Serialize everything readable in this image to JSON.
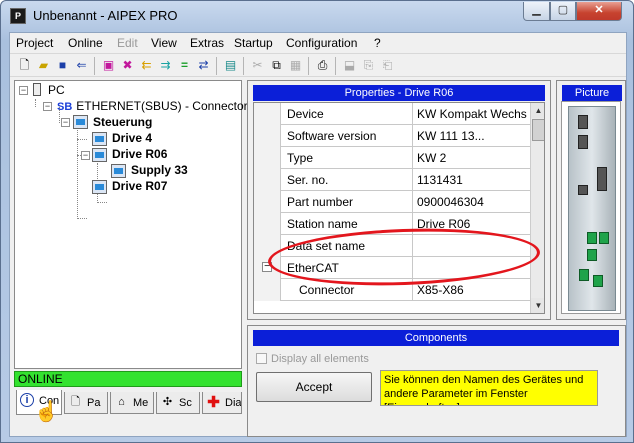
{
  "window": {
    "title": "Unbenannt - AIPEX PRO",
    "app_icon": "P",
    "minimize_glyph": "▁",
    "maximize_glyph": "▢",
    "close_glyph": "✕"
  },
  "menu": [
    "Project",
    "Online",
    "Edit",
    "View",
    "Extras",
    "Startup",
    "Configuration",
    "?"
  ],
  "menu_disabled": [
    "Edit"
  ],
  "toolbar": {
    "icons": [
      "new-file-icon",
      "open-folder-icon",
      "save-icon",
      "login-icon",
      "pink-device-icon",
      "disconnect-icon",
      "arrow-left-icon",
      "arrow-right-icon",
      "equals-icon",
      "transfer-icon",
      "calculator-icon",
      "cut-icon",
      "copy-icon",
      "paste-icon",
      "print-icon",
      "upload-icon",
      "printer-up-icon",
      "printer-down-icon"
    ]
  },
  "tree": {
    "pc": "PC",
    "sb_prefix": "SB",
    "ethernet": "ETHERNET(SBUS) - Connector",
    "steuerung": "Steuerung",
    "drive4": "Drive 4",
    "drive_r06": "Drive R06",
    "supply33": "Supply 33",
    "drive_r07": "Drive R07"
  },
  "status": {
    "online": "ONLINE"
  },
  "tabs": [
    {
      "label": "Con",
      "icon": "info-icon"
    },
    {
      "label": "Pa",
      "icon": "document-icon"
    },
    {
      "label": "Me",
      "icon": "house-icon"
    },
    {
      "label": "Sc",
      "icon": "scope-icon"
    },
    {
      "label": "Dia",
      "icon": "red-cross-icon"
    }
  ],
  "properties": {
    "title": "Properties - Drive R06",
    "rows": [
      {
        "name": "Device",
        "value": "KW   Kompakt Wechs"
      },
      {
        "name": "Software version",
        "value": "KW  111 13..."
      },
      {
        "name": "Type",
        "value": "KW 2"
      },
      {
        "name": "Ser. no.",
        "value": "1131431"
      },
      {
        "name": "Part number",
        "value": "0900046304"
      },
      {
        "name": "Station name",
        "value": "Drive R06"
      },
      {
        "name": "Data set name",
        "value": ""
      },
      {
        "name": "EtherCAT",
        "value": "",
        "collapsible": true
      },
      {
        "name": "Connector",
        "value": "X85-X86",
        "indent": true
      }
    ],
    "highlight_color": "#e3161d"
  },
  "picture": {
    "title": "Picture"
  },
  "components": {
    "title": "Components",
    "display_all": "Display all elements",
    "accept": "Accept",
    "hint": "Sie können den Namen des Gerätes und andere Parameter im Fenster [Eigenschaften]"
  },
  "colors": {
    "panel_title_bg": "#0b1fd8",
    "online_bg": "#33e22f",
    "hint_bg": "#ffff00"
  }
}
